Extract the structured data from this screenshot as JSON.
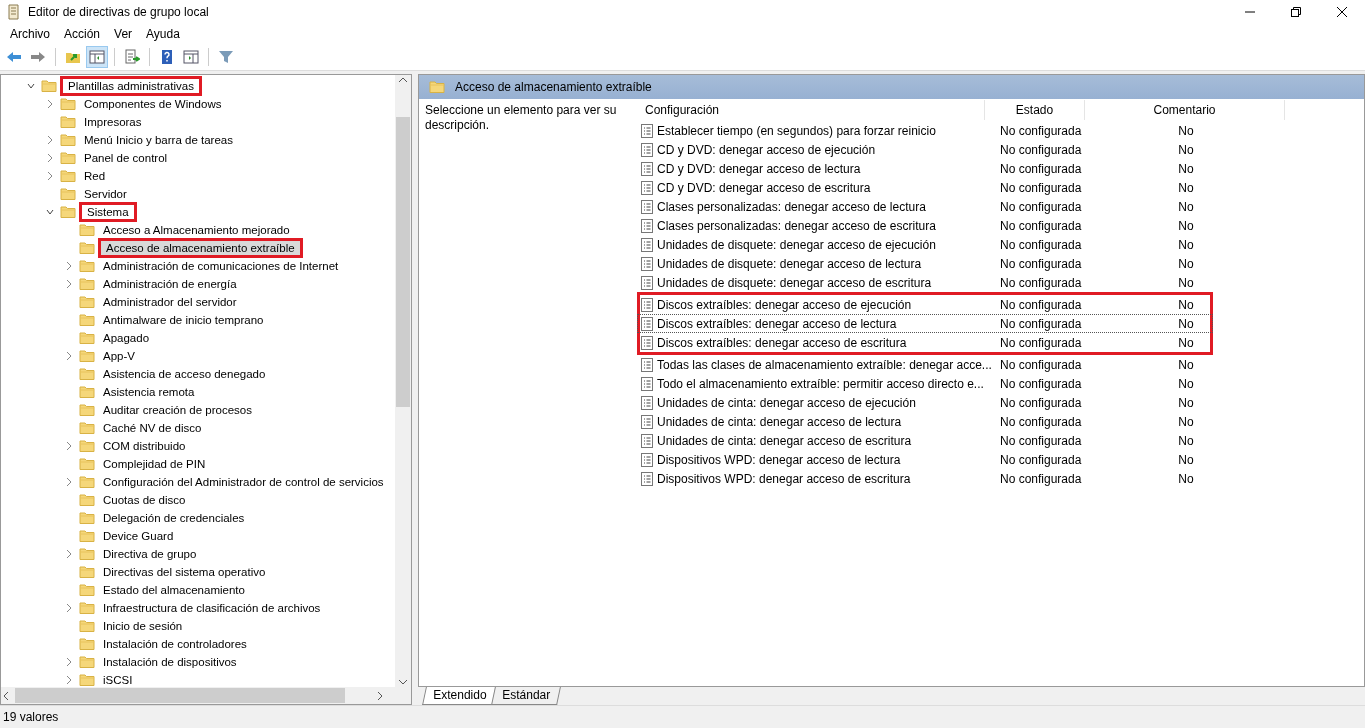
{
  "window": {
    "title": "Editor de directivas de grupo local"
  },
  "menu": [
    "Archivo",
    "Acción",
    "Ver",
    "Ayuda"
  ],
  "tree": [
    {
      "label": "Plantillas administrativas",
      "kind": "branch",
      "expanded": true,
      "selected": false,
      "highlighted": true,
      "children": [
        {
          "label": "Componentes de Windows",
          "kind": "branch",
          "expanded": false,
          "selected": false,
          "highlighted": false
        },
        {
          "label": "Impresoras",
          "kind": "leaf",
          "selected": false,
          "highlighted": false
        },
        {
          "label": "Menú Inicio y barra de tareas",
          "kind": "branch",
          "expanded": false,
          "selected": false,
          "highlighted": false
        },
        {
          "label": "Panel de control",
          "kind": "branch",
          "expanded": false,
          "selected": false,
          "highlighted": false
        },
        {
          "label": "Red",
          "kind": "branch",
          "expanded": false,
          "selected": false,
          "highlighted": false
        },
        {
          "label": "Servidor",
          "kind": "leaf",
          "selected": false,
          "highlighted": false
        },
        {
          "label": "Sistema",
          "kind": "branch",
          "expanded": true,
          "selected": false,
          "highlighted": true,
          "children": [
            {
              "label": "Acceso a Almacenamiento mejorado",
              "kind": "leaf",
              "selected": false,
              "highlighted": false
            },
            {
              "label": "Acceso de almacenamiento extraíble",
              "kind": "leaf",
              "selected": true,
              "highlighted": true
            },
            {
              "label": "Administración de comunicaciones de Internet",
              "kind": "branch",
              "expanded": false,
              "selected": false,
              "highlighted": false
            },
            {
              "label": "Administración de energía",
              "kind": "branch",
              "expanded": false,
              "selected": false,
              "highlighted": false
            },
            {
              "label": "Administrador del servidor",
              "kind": "leaf",
              "selected": false,
              "highlighted": false
            },
            {
              "label": "Antimalware de inicio temprano",
              "kind": "leaf",
              "selected": false,
              "highlighted": false
            },
            {
              "label": "Apagado",
              "kind": "leaf",
              "selected": false,
              "highlighted": false
            },
            {
              "label": "App-V",
              "kind": "branch",
              "expanded": false,
              "selected": false,
              "highlighted": false
            },
            {
              "label": "Asistencia de acceso denegado",
              "kind": "leaf",
              "selected": false,
              "highlighted": false
            },
            {
              "label": "Asistencia remota",
              "kind": "leaf",
              "selected": false,
              "highlighted": false
            },
            {
              "label": "Auditar creación de procesos",
              "kind": "leaf",
              "selected": false,
              "highlighted": false
            },
            {
              "label": "Caché NV de disco",
              "kind": "leaf",
              "selected": false,
              "highlighted": false
            },
            {
              "label": "COM distribuido",
              "kind": "branch",
              "expanded": false,
              "selected": false,
              "highlighted": false
            },
            {
              "label": "Complejidad de PIN",
              "kind": "leaf",
              "selected": false,
              "highlighted": false
            },
            {
              "label": "Configuración del Administrador de control de servicios",
              "kind": "branch",
              "expanded": false,
              "selected": false,
              "highlighted": false
            },
            {
              "label": "Cuotas de disco",
              "kind": "leaf",
              "selected": false,
              "highlighted": false
            },
            {
              "label": "Delegación de credenciales",
              "kind": "leaf",
              "selected": false,
              "highlighted": false
            },
            {
              "label": "Device Guard",
              "kind": "leaf",
              "selected": false,
              "highlighted": false
            },
            {
              "label": "Directiva de grupo",
              "kind": "branch",
              "expanded": false,
              "selected": false,
              "highlighted": false
            },
            {
              "label": "Directivas del sistema operativo",
              "kind": "leaf",
              "selected": false,
              "highlighted": false
            },
            {
              "label": "Estado del almacenamiento",
              "kind": "leaf",
              "selected": false,
              "highlighted": false
            },
            {
              "label": "Infraestructura de clasificación de archivos",
              "kind": "branch",
              "expanded": false,
              "selected": false,
              "highlighted": false
            },
            {
              "label": "Inicio de sesión",
              "kind": "leaf",
              "selected": false,
              "highlighted": false
            },
            {
              "label": "Instalación de controladores",
              "kind": "leaf",
              "selected": false,
              "highlighted": false
            },
            {
              "label": "Instalación de dispositivos",
              "kind": "branch",
              "expanded": false,
              "selected": false,
              "highlighted": false
            },
            {
              "label": "iSCSI",
              "kind": "branch",
              "expanded": false,
              "selected": false,
              "highlighted": false
            }
          ]
        }
      ]
    }
  ],
  "details": {
    "header": "Acceso de almacenamiento extraíble",
    "description": "Seleccione un elemento para ver su descripción.",
    "columns": [
      "Configuración",
      "Estado",
      "Comentario"
    ],
    "rows": [
      {
        "setting": "Establecer tiempo (en segundos) para forzar reinicio",
        "state": "No configurada",
        "comment": "No",
        "focused": false,
        "highlighted": false
      },
      {
        "setting": "CD y DVD: denegar acceso de ejecución",
        "state": "No configurada",
        "comment": "No",
        "focused": false,
        "highlighted": false
      },
      {
        "setting": "CD y DVD: denegar acceso de lectura",
        "state": "No configurada",
        "comment": "No",
        "focused": false,
        "highlighted": false
      },
      {
        "setting": "CD y DVD: denegar acceso de escritura",
        "state": "No configurada",
        "comment": "No",
        "focused": false,
        "highlighted": false
      },
      {
        "setting": "Clases personalizadas: denegar acceso de lectura",
        "state": "No configurada",
        "comment": "No",
        "focused": false,
        "highlighted": false
      },
      {
        "setting": "Clases personalizadas: denegar acceso de escritura",
        "state": "No configurada",
        "comment": "No",
        "focused": false,
        "highlighted": false
      },
      {
        "setting": "Unidades de disquete: denegar acceso de ejecución",
        "state": "No configurada",
        "comment": "No",
        "focused": false,
        "highlighted": false
      },
      {
        "setting": "Unidades de disquete: denegar acceso de lectura",
        "state": "No configurada",
        "comment": "No",
        "focused": false,
        "highlighted": false
      },
      {
        "setting": "Unidades de disquete: denegar acceso de escritura",
        "state": "No configurada",
        "comment": "No",
        "focused": false,
        "highlighted": false
      },
      {
        "setting": "Discos extraíbles: denegar acceso de ejecución",
        "state": "No configurada",
        "comment": "No",
        "focused": false,
        "highlighted": true
      },
      {
        "setting": "Discos extraíbles: denegar acceso de lectura",
        "state": "No configurada",
        "comment": "No",
        "focused": true,
        "highlighted": true
      },
      {
        "setting": "Discos extraíbles: denegar acceso de escritura",
        "state": "No configurada",
        "comment": "No",
        "focused": false,
        "highlighted": true
      },
      {
        "setting": "Todas las clases de almacenamiento extraíble: denegar acce...",
        "state": "No configurada",
        "comment": "No",
        "focused": false,
        "highlighted": false
      },
      {
        "setting": "Todo el almacenamiento extraíble: permitir acceso directo e...",
        "state": "No configurada",
        "comment": "No",
        "focused": false,
        "highlighted": false
      },
      {
        "setting": "Unidades de cinta: denegar acceso de ejecución",
        "state": "No configurada",
        "comment": "No",
        "focused": false,
        "highlighted": false
      },
      {
        "setting": "Unidades de cinta: denegar acceso de lectura",
        "state": "No configurada",
        "comment": "No",
        "focused": false,
        "highlighted": false
      },
      {
        "setting": "Unidades de cinta: denegar acceso de escritura",
        "state": "No configurada",
        "comment": "No",
        "focused": false,
        "highlighted": false
      },
      {
        "setting": "Dispositivos WPD: denegar acceso de lectura",
        "state": "No configurada",
        "comment": "No",
        "focused": false,
        "highlighted": false
      },
      {
        "setting": "Dispositivos WPD: denegar acceso de escritura",
        "state": "No configurada",
        "comment": "No",
        "focused": false,
        "highlighted": false
      }
    ],
    "tabs": [
      {
        "label": "Extendido",
        "selected": true
      },
      {
        "label": "Estándar",
        "selected": false
      }
    ]
  },
  "status_bar": "19 valores"
}
